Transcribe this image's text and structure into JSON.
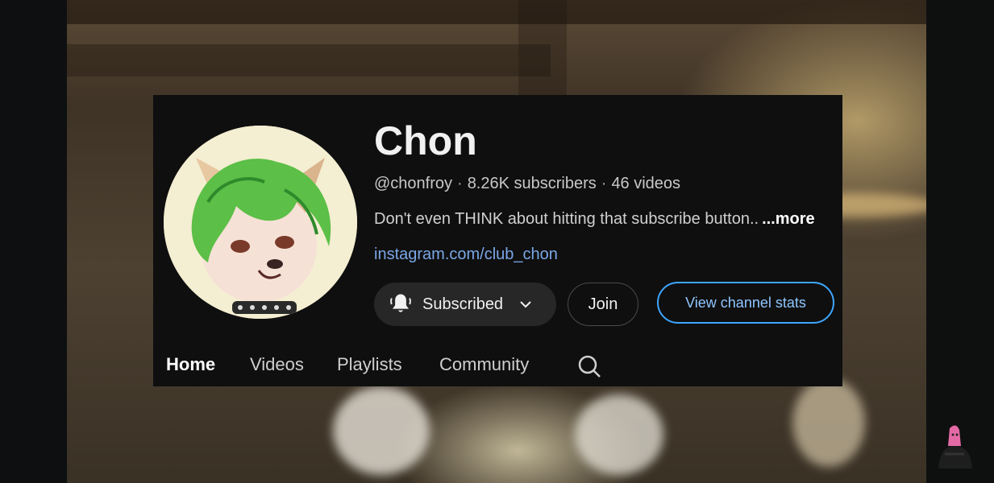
{
  "channel": {
    "name": "Chon",
    "handle": "@chonfroy",
    "subscribers": "8.26K subscribers",
    "videos": "46 videos",
    "description": "Don't even THINK about hitting that subscribe button..",
    "more_label": "...more",
    "link": "instagram.com/club_chon"
  },
  "actions": {
    "subscribed_label": "Subscribed",
    "join_label": "Join",
    "stats_label": "View channel stats"
  },
  "tabs": [
    {
      "label": "Home",
      "active": true
    },
    {
      "label": "Videos",
      "active": false
    },
    {
      "label": "Playlists",
      "active": false
    },
    {
      "label": "Community",
      "active": false
    }
  ],
  "icons": {
    "notification": "bell-icon",
    "dropdown": "chevron-down-icon",
    "search": "search-icon"
  },
  "colors": {
    "card_bg": "#0f0f0f",
    "link": "#7aa7e6",
    "stats_border": "#3ea6ff",
    "button_bg": "#272727"
  }
}
